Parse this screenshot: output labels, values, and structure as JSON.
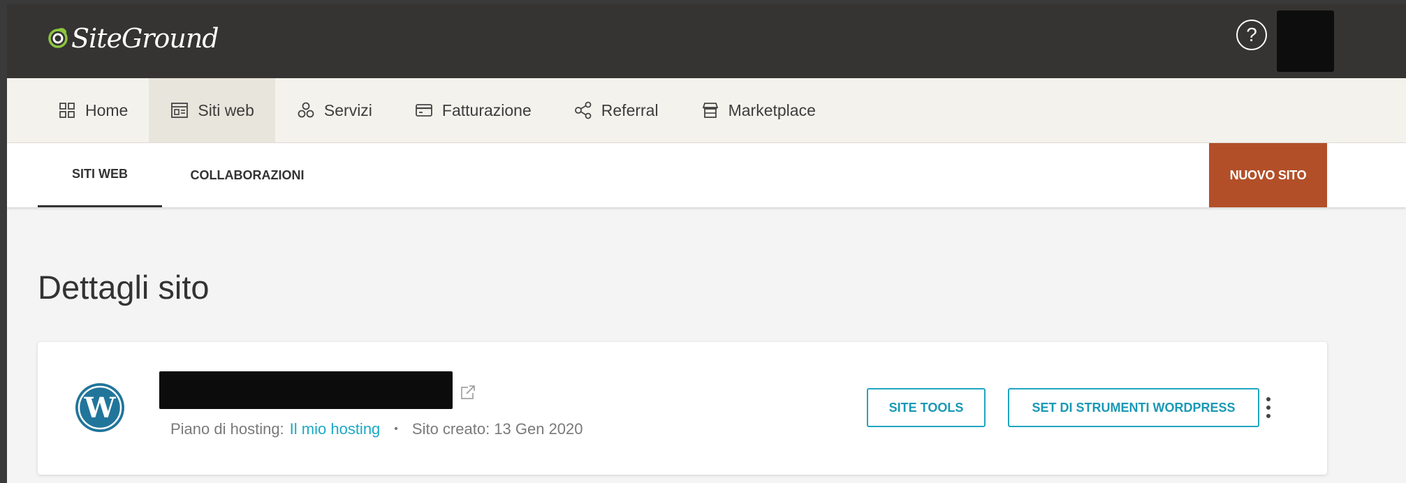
{
  "brand": {
    "name": "SiteGround"
  },
  "header": {
    "help_glyph": "?"
  },
  "main_nav": {
    "items": [
      {
        "label": "Home",
        "icon": "grid-icon"
      },
      {
        "label": "Siti web",
        "icon": "website-icon",
        "active": true
      },
      {
        "label": "Servizi",
        "icon": "services-icon"
      },
      {
        "label": "Fatturazione",
        "icon": "card-icon"
      },
      {
        "label": "Referral",
        "icon": "share-icon"
      },
      {
        "label": "Marketplace",
        "icon": "store-icon"
      }
    ]
  },
  "sub_nav": {
    "tabs": [
      {
        "label": "SITI WEB",
        "active": true
      },
      {
        "label": "COLLABORAZIONI"
      }
    ],
    "new_site_label": "NUOVO SITO"
  },
  "page": {
    "title": "Dettagli sito"
  },
  "site": {
    "plan_label": "Piano di hosting:",
    "plan_value": "Il mio hosting",
    "separator": "•",
    "created_text": "Sito creato: 13 Gen 2020",
    "site_tools_label": "SITE TOOLS",
    "wp_tools_label": "SET DI STRUMENTI WORDPRESS"
  },
  "colors": {
    "topbar": "#353432",
    "accent_orange": "#b24f28",
    "accent_teal": "#1ba9c4",
    "wordpress_blue": "#21759b"
  }
}
